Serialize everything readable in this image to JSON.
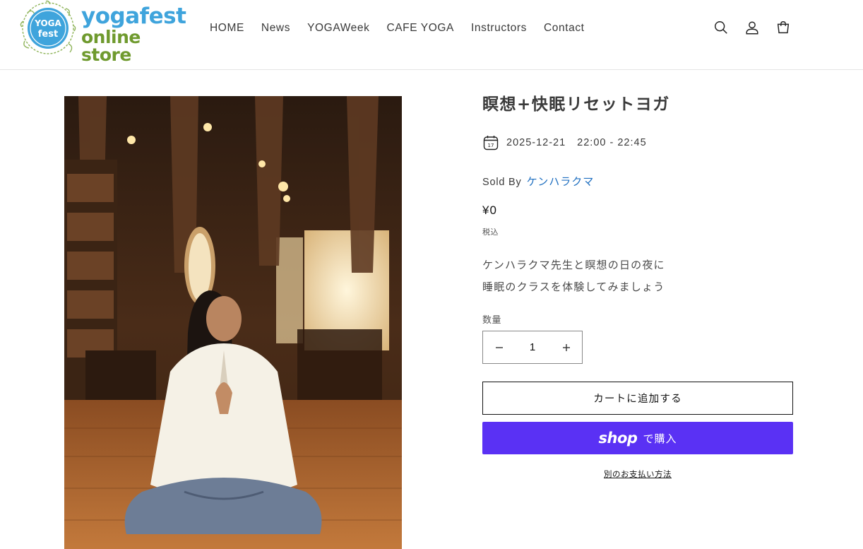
{
  "header": {
    "logo": {
      "line1": "yogafest",
      "line2": "online store",
      "badge_text": "YOGA fest"
    },
    "nav": [
      {
        "label": "HOME"
      },
      {
        "label": "News"
      },
      {
        "label": "YOGAWeek"
      },
      {
        "label": "CAFE YOGA"
      },
      {
        "label": "Instructors"
      },
      {
        "label": "Contact"
      }
    ],
    "icons": [
      "search-icon",
      "account-icon",
      "cart-icon"
    ]
  },
  "product": {
    "title": "瞑想+快眠リセットヨガ",
    "date": "2025-12-21",
    "time": "22:00 - 22:45",
    "calendar_day": "17",
    "sold_by_label": "Sold By",
    "seller": "ケンハラクマ",
    "price": "¥0",
    "tax_note": "税込",
    "description": [
      "ケンハラクマ先生と瞑想の日の夜に",
      "睡眠のクラスを体験してみましょう"
    ],
    "quantity_label": "数量",
    "quantity_value": "1",
    "add_to_cart": "カートに追加する",
    "shop_pay_word": "shop",
    "shop_pay_buy": "で購入",
    "alt_payment": "別のお支払い方法"
  },
  "colors": {
    "accent_blue": "#3fa4dc",
    "accent_green": "#6f9a2e",
    "link": "#1f6fc0",
    "shop_pay": "#5a31f4"
  }
}
